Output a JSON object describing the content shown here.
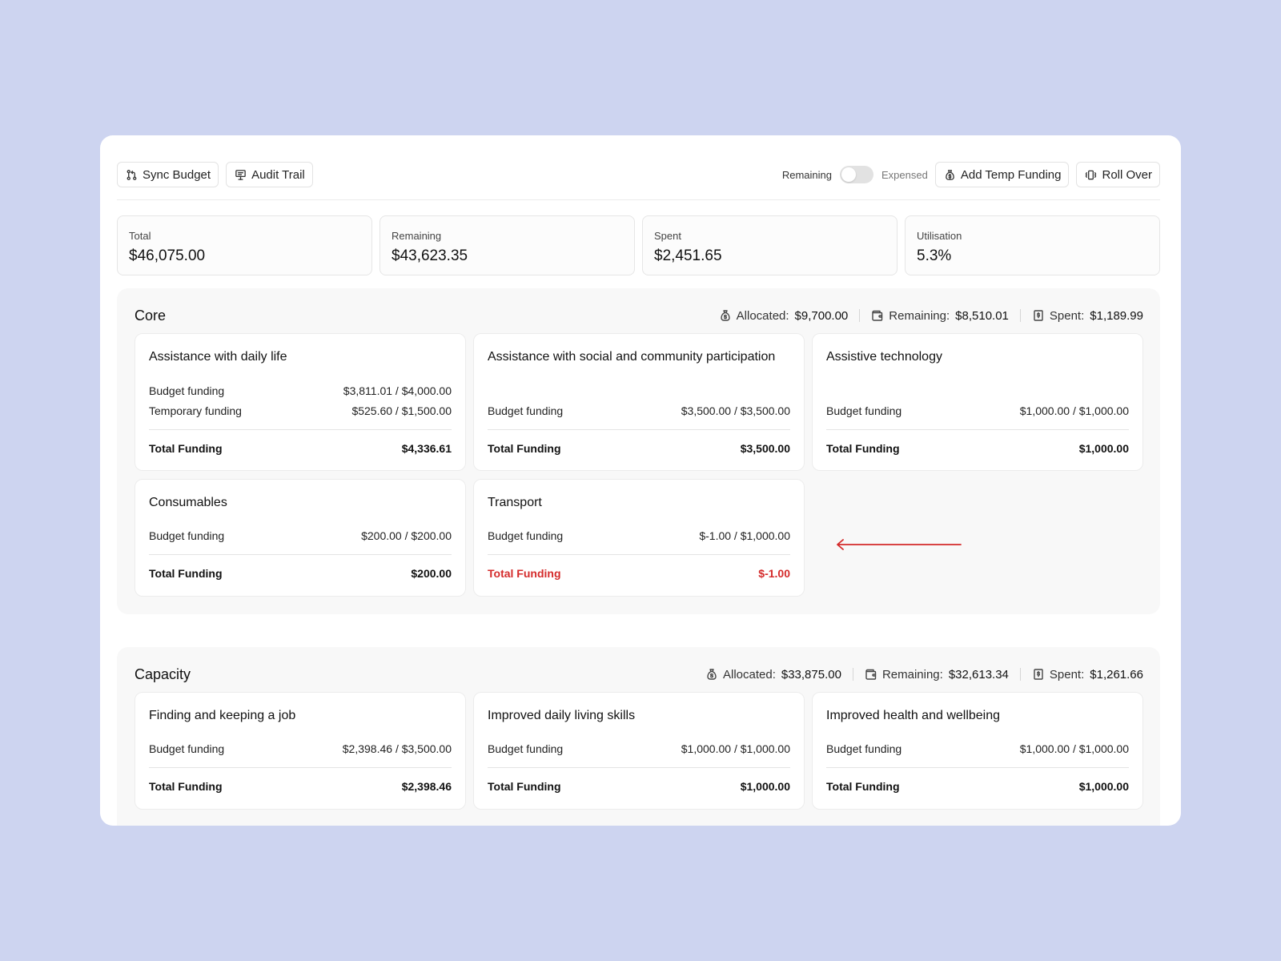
{
  "toolbar": {
    "sync_label": "Sync Budget",
    "audit_label": "Audit Trail",
    "toggle_left": "Remaining",
    "toggle_right": "Expensed",
    "add_temp_label": "Add Temp Funding",
    "rollover_label": "Roll Over"
  },
  "stats": [
    {
      "label": "Total",
      "value": "$46,075.00"
    },
    {
      "label": "Remaining",
      "value": "$43,623.35"
    },
    {
      "label": "Spent",
      "value": "$2,451.65"
    },
    {
      "label": "Utilisation",
      "value": "5.3%"
    }
  ],
  "sections": [
    {
      "title": "Core",
      "allocated_label": "Allocated:",
      "allocated": "$9,700.00",
      "remaining_label": "Remaining:",
      "remaining": "$8,510.01",
      "spent_label": "Spent:",
      "spent": "$1,189.99",
      "cards": [
        {
          "title": "Assistance with daily life",
          "rows": [
            {
              "label": "Budget funding",
              "value": "$3,811.01 / $4,000.00"
            },
            {
              "label": "Temporary funding",
              "value": "$525.60 / $1,500.00"
            }
          ],
          "total_label": "Total Funding",
          "total": "$4,336.61"
        },
        {
          "title": "Assistance with social and community participation",
          "rows": [
            {
              "label": "Budget funding",
              "value": "$3,500.00 / $3,500.00"
            }
          ],
          "total_label": "Total Funding",
          "total": "$3,500.00"
        },
        {
          "title": "Assistive technology",
          "rows": [
            {
              "label": "Budget funding",
              "value": "$1,000.00 / $1,000.00"
            }
          ],
          "total_label": "Total Funding",
          "total": "$1,000.00"
        },
        {
          "title": "Consumables",
          "rows": [
            {
              "label": "Budget funding",
              "value": "$200.00 / $200.00"
            }
          ],
          "total_label": "Total Funding",
          "total": "$200.00"
        },
        {
          "title": "Transport",
          "rows": [
            {
              "label": "Budget funding",
              "value": "$-1.00 / $1,000.00"
            }
          ],
          "total_label": "Total Funding",
          "total": "$-1.00"
        }
      ]
    },
    {
      "title": "Capacity",
      "allocated_label": "Allocated:",
      "allocated": "$33,875.00",
      "remaining_label": "Remaining:",
      "remaining": "$32,613.34",
      "spent_label": "Spent:",
      "spent": "$1,261.66",
      "cards": [
        {
          "title": "Finding and keeping a job",
          "rows": [
            {
              "label": "Budget funding",
              "value": "$2,398.46 / $3,500.00"
            }
          ],
          "total_label": "Total Funding",
          "total": "$2,398.46"
        },
        {
          "title": "Improved daily living skills",
          "rows": [
            {
              "label": "Budget funding",
              "value": "$1,000.00 / $1,000.00"
            }
          ],
          "total_label": "Total Funding",
          "total": "$1,000.00"
        },
        {
          "title": "Improved health and wellbeing",
          "rows": [
            {
              "label": "Budget funding",
              "value": "$1,000.00 / $1,000.00"
            }
          ],
          "total_label": "Total Funding",
          "total": "$1,000.00"
        }
      ]
    }
  ],
  "colors": {
    "background": "#cdd4f0",
    "negative": "#d42a2a",
    "annotation_arrow": "#d42a2a"
  }
}
